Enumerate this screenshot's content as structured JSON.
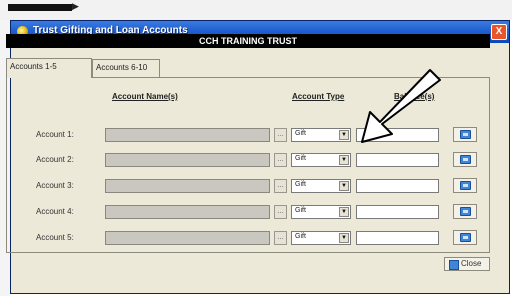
{
  "window": {
    "title": "Trust Gifting and Loan Accounts",
    "close_glyph": "X"
  },
  "trust": {
    "name": "CCH TRAINING TRUST"
  },
  "tabs": [
    {
      "label": "Accounts 1-5",
      "active": true
    },
    {
      "label": "Accounts 6-10",
      "active": false
    }
  ],
  "columns": {
    "name": "Account Name(s)",
    "type": "Account Type",
    "balance": "Balance(s)"
  },
  "rows": [
    {
      "label": "Account 1:",
      "name": "",
      "type": "Gift",
      "balance": ""
    },
    {
      "label": "Account 2:",
      "name": "",
      "type": "Gift",
      "balance": ""
    },
    {
      "label": "Account 3:",
      "name": "",
      "type": "Gift",
      "balance": ""
    },
    {
      "label": "Account 4:",
      "name": "",
      "type": "Gift",
      "balance": ""
    },
    {
      "label": "Account 5:",
      "name": "",
      "type": "Gift",
      "balance": ""
    }
  ],
  "icons": {
    "lookup": "ellipsis-icon",
    "dropdown": "chevron-down-icon",
    "row_button": "notes-icon",
    "close_button": "door-icon",
    "annotation": "arrow-icon"
  },
  "footer": {
    "close_label": "Close"
  },
  "colors": {
    "titlebar": "#1f5fcf",
    "trust_bar": "#000000",
    "window_bg": "#ece9d8",
    "annotation_arrow": "#000000"
  }
}
